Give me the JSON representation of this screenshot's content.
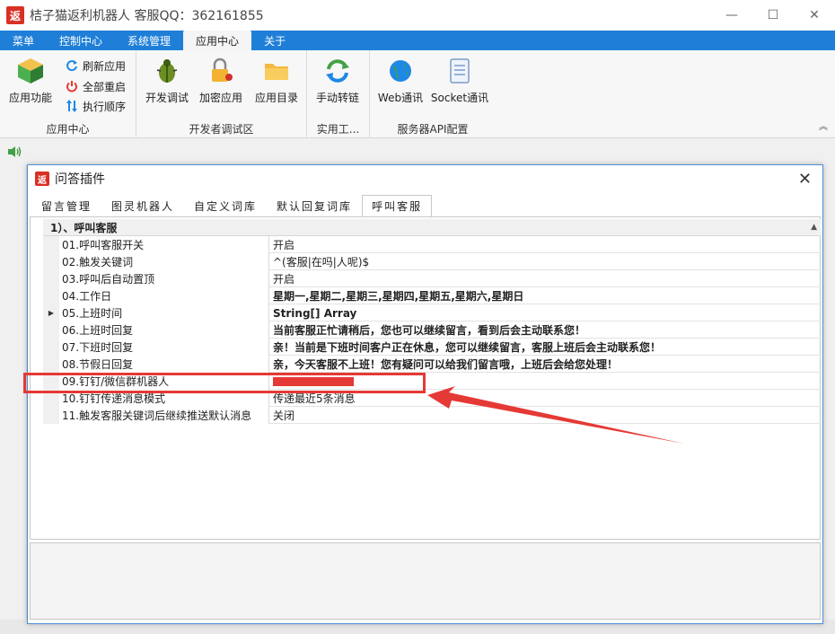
{
  "window": {
    "logo": "返",
    "title": "桔子猫返利机器人 客服QQ：362161855",
    "minimize": "—",
    "maximize": "☐",
    "close": "✕"
  },
  "menubar": {
    "tabs": [
      "菜单",
      "控制中心",
      "系统管理",
      "应用中心",
      "关于"
    ],
    "active": "应用中心"
  },
  "ribbon": {
    "group_app": {
      "label": "应用中心",
      "big": "应用功能",
      "small": [
        "刷新应用",
        "全部重启",
        "执行顺序"
      ]
    },
    "group_dev": {
      "label": "开发者调试区",
      "buttons": [
        "开发调试",
        "加密应用",
        "应用目录"
      ]
    },
    "group_tools": {
      "label": "实用工...",
      "buttons": [
        "手动转链"
      ]
    },
    "group_api": {
      "label": "服务器API配置",
      "buttons": [
        "Web通讯",
        "Socket通讯"
      ]
    }
  },
  "dialog": {
    "logo": "返",
    "title": "问答插件",
    "close": "✕",
    "tabs": [
      "留言管理",
      "图灵机器人",
      "自定义词库",
      "默认回复词库",
      "呼叫客服"
    ],
    "active_tab": "呼叫客服",
    "section": "1）、呼叫客服",
    "rows": [
      {
        "name": "01.呼叫客服开关",
        "value": "开启"
      },
      {
        "name": "02.触发关键词",
        "value": "^(客服|在吗|人呢)$"
      },
      {
        "name": "03.呼叫后自动置顶",
        "value": "开启"
      },
      {
        "name": "04.工作日",
        "value": "星期一,星期二,星期三,星期四,星期五,星期六,星期日"
      },
      {
        "name": "05.上班时间",
        "value": "String[] Array"
      },
      {
        "name": "06.上班时回复",
        "value": "当前客服正忙请稍后，您也可以继续留言，看到后会主动联系您！"
      },
      {
        "name": "07.下班时回复",
        "value": "亲！当前是下班时间客户正在休息，您可以继续留言，客服上班后会主动联系您！"
      },
      {
        "name": "08.节假日回复",
        "value": "亲，今天客服不上班！您有疑问可以给我们留言哦，上班后会给您处理！"
      },
      {
        "name": "09.钉钉/微信群机器人",
        "value": ""
      },
      {
        "name": "10.钉钉传递消息模式",
        "value": "传递最近5条消息"
      },
      {
        "name": "11.触发客服关键词后继续推送默认消息",
        "value": "关闭"
      }
    ]
  },
  "colors": {
    "menubar": "#1f7fd8",
    "accent_red": "#e53935",
    "dialog_border": "#4a8fd6"
  }
}
